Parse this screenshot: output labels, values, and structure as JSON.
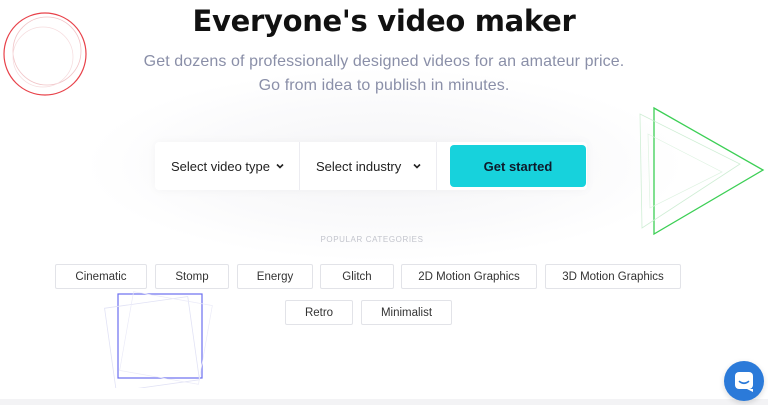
{
  "hero": {
    "title": "Everyone's video maker",
    "subtitle_line1": "Get dozens of professionally designed videos for an amateur price.",
    "subtitle_line2": "Go from idea to publish in minutes."
  },
  "search": {
    "video_type_label": "Select video type",
    "industry_label": "Select industry",
    "cta_label": "Get started",
    "accent_color": "#17d2dc"
  },
  "categories": {
    "heading": "POPULAR CATEGORIES",
    "row1": [
      "Cinematic",
      "Stomp",
      "Energy",
      "Glitch",
      "2D Motion Graphics",
      "3D Motion Graphics"
    ],
    "row2": [
      "Retro",
      "Minimalist"
    ]
  },
  "decorations": {
    "circle_color": "#e8424a",
    "triangle_color": "#3ccf55",
    "square_color": "#6b6ef0"
  },
  "chat": {
    "icon": "chat-bubble-icon",
    "color": "#2b7ad9"
  }
}
